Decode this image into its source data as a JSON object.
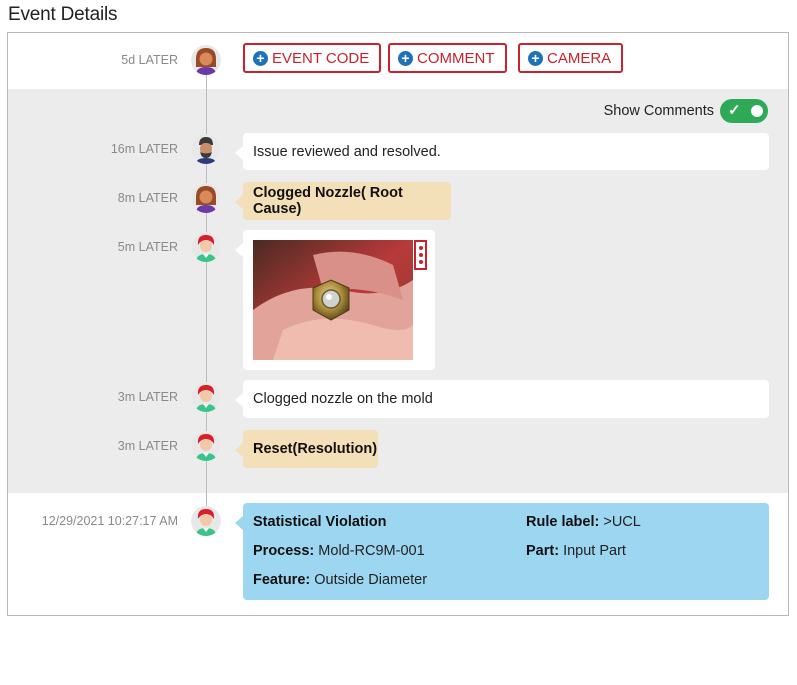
{
  "page": {
    "title": "Event Details"
  },
  "actions": {
    "event_code": "EVENT CODE",
    "comment": "COMMENT",
    "camera": "CAMERA"
  },
  "comments_toggle": {
    "label": "Show Comments",
    "on": true
  },
  "timeline": {
    "top": {
      "time": "5d LATER"
    },
    "entries": [
      {
        "time": "16m LATER",
        "text": "Issue reviewed and resolved."
      },
      {
        "time": "8m LATER",
        "text": "Clogged Nozzle( Root Cause)"
      },
      {
        "time": "5m LATER",
        "text": ""
      },
      {
        "time": "3m LATER",
        "text": "Clogged nozzle on the mold"
      },
      {
        "time": "3m LATER",
        "text": "Reset(Resolution)"
      }
    ],
    "violation": {
      "time": "12/29/2021 10:27:17 AM",
      "title": "Statistical Violation",
      "process_label": "Process:",
      "process_value": "Mold-RC9M-001",
      "feature_label": "Feature:",
      "feature_value": "Outside Diameter",
      "rule_label": "Rule label:",
      "rule_value": ">UCL",
      "part_label": "Part:",
      "part_value": "Input Part"
    }
  },
  "colors": {
    "accent_red": "#c8232c",
    "plus_blue": "#1e73b8",
    "toggle_green": "#2eaa57",
    "tan_bubble": "#f3dfb8",
    "violation_blue": "#9dd6f0",
    "gray_zone": "#ececec"
  },
  "icons": {
    "plus": "plus-circle-icon",
    "check": "check-icon",
    "kebab": "kebab-menu-icon"
  }
}
